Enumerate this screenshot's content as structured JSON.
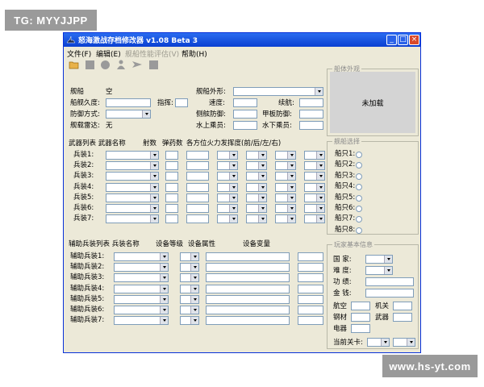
{
  "watermarks": {
    "top_left": "TG: MYYJJPP",
    "bottom_right": "www.hs-yt.com"
  },
  "window": {
    "title": "怒海激战存档修改器 v1.08 Beta 3",
    "min": "_",
    "max": "□",
    "close": "×"
  },
  "menu": [
    {
      "label": "文件(F)",
      "enabled": true
    },
    {
      "label": "编辑(E)",
      "enabled": true
    },
    {
      "label": "舰船性能评估(V)",
      "enabled": false
    },
    {
      "label": "帮助(H)",
      "enabled": true
    }
  ],
  "toolbar_icons": [
    "open-folder-icon",
    "save-icon",
    "circle-icon",
    "person-icon",
    "arrow-icon",
    "square-icon"
  ],
  "ship_info": {
    "ship_label": "舰船",
    "ship_value": "空",
    "durability_label": "船舰久度:",
    "command_label": "指挥:",
    "defense_label": "防御方式:",
    "radar_label": "舰载雷达:",
    "radar_value": "无",
    "shape_label": "舰船外形:",
    "speed_label": "速度:",
    "range_label": "续航:",
    "side_armor_label": "侧舷防御:",
    "deck_armor_label": "甲板防御:",
    "surface_crew_label": "水上乘员:",
    "underwater_crew_label": "水下乘员:"
  },
  "weapons": {
    "header": "武器列表 武器名称",
    "rate_header": "射数",
    "ammo_header": "弹药数",
    "arc_header": "各方位火力发挥度(前/后/左/右)",
    "rows": [
      "兵装1:",
      "兵装2:",
      "兵装3:",
      "兵装4:",
      "兵装5:",
      "兵装6:",
      "兵装7:"
    ]
  },
  "aux": {
    "header": "辅助兵装列表 兵装名称",
    "level_header": "设备等级",
    "attr_header": "设备属性",
    "var_header": "设备变量",
    "rows": [
      "辅助兵装1:",
      "辅助兵装2:",
      "辅助兵装3:",
      "辅助兵装4:",
      "辅助兵装5:",
      "辅助兵装6:",
      "辅助兵装7:"
    ]
  },
  "preview": {
    "group_title": "船体外观",
    "empty_text": "未加载"
  },
  "ship_select": {
    "group_title": "舰船选择",
    "items": [
      "船只1:",
      "船只2:",
      "船只3:",
      "船只4:",
      "船只5:",
      "船只6:",
      "船只7:",
      "船只8:"
    ]
  },
  "player": {
    "group_title": "玩家基本信息",
    "country_label": "国 家:",
    "difficulty_label": "难 度:",
    "merit_label": "功 绩:",
    "money_label": "金 钱:",
    "aviation_label": "航空",
    "engine_label": "机关",
    "steel_label": "钢材",
    "weapon_label": "武器",
    "electric_label": "电器",
    "stage_label": "当前关卡:"
  }
}
